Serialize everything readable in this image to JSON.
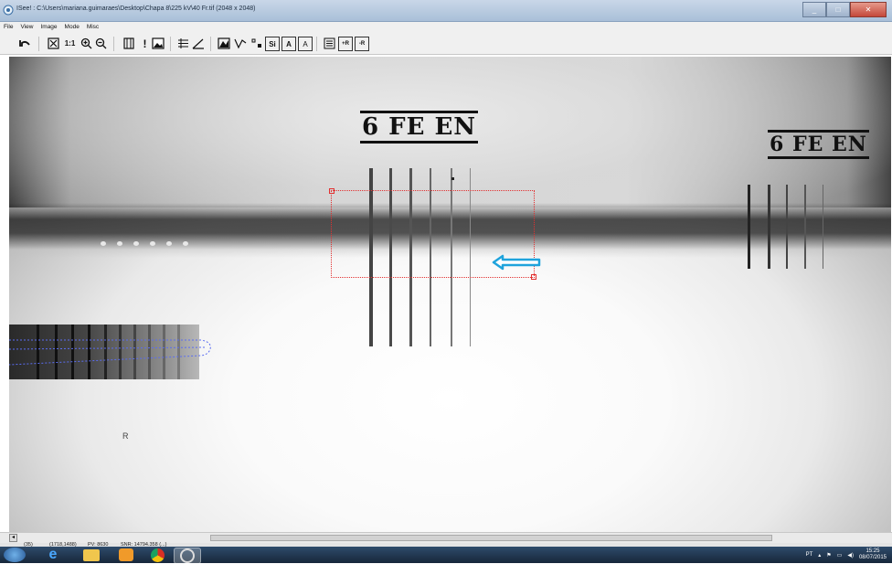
{
  "window": {
    "title": "ISee! : C:\\Users\\mariana.guimaraes\\Desktop\\Chapa 8\\225 kV\\40 Fr.tif (2048 x 2048)",
    "controls": [
      "minimize",
      "maximize",
      "close"
    ]
  },
  "menu": [
    "File",
    "View",
    "Image",
    "Mode",
    "Misc"
  ],
  "toolbar": {
    "buttons": [
      {
        "name": "undo-icon"
      },
      {
        "name": "fit-window-icon"
      },
      {
        "name": "actual-size-button",
        "label": "1:1"
      },
      {
        "name": "zoom-in-icon"
      },
      {
        "name": "zoom-out-icon"
      },
      {
        "name": "invert-icon"
      },
      {
        "name": "alert-icon",
        "label": "!"
      },
      {
        "name": "image-icon"
      },
      {
        "name": "grid-icon"
      },
      {
        "name": "angle-icon"
      },
      {
        "name": "profile-icon"
      },
      {
        "name": "polyline-icon"
      },
      {
        "name": "points-icon"
      },
      {
        "name": "si-button",
        "label": "Si"
      },
      {
        "name": "a-box-button",
        "label": "A"
      },
      {
        "name": "a-outline-button",
        "label": "A"
      },
      {
        "name": "list-icon"
      },
      {
        "name": "plus-r-button",
        "label": "+R"
      },
      {
        "name": "minus-r-button",
        "label": "-R"
      }
    ]
  },
  "image": {
    "labels": [
      "6 FE EN",
      "6 FE EN"
    ],
    "marker": "R",
    "roi_color": "#e23030",
    "arrow_color": "#1fa3dc"
  },
  "status": {
    "zoom": "(35)",
    "position": "(1718,1488)",
    "pixel_value": "PV: 8630",
    "snr": "SNR: 14794.358 (...)"
  },
  "taskbar": {
    "apps": [
      "start-orb",
      "internet-explorer",
      "file-explorer",
      "media-player",
      "chrome",
      "isee"
    ],
    "tray_lang": "PT",
    "time": "15:25",
    "date": "08/07/2015"
  }
}
